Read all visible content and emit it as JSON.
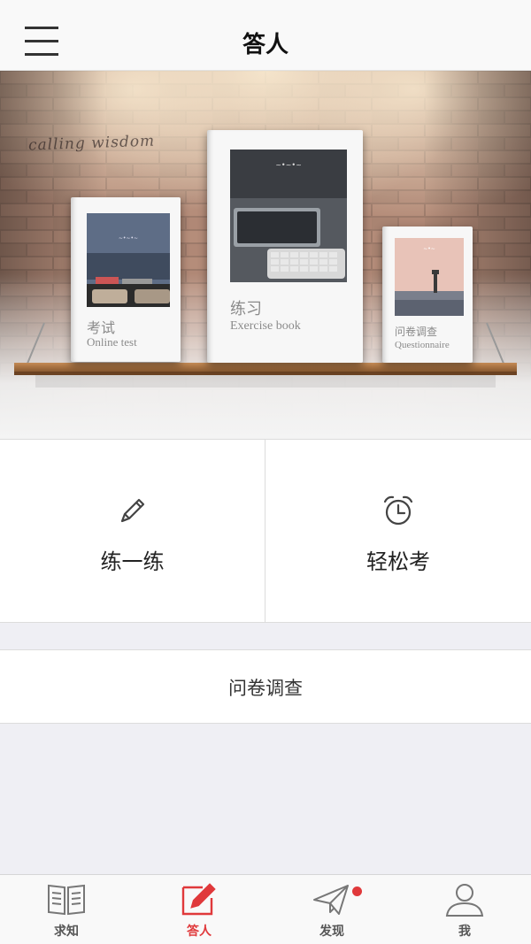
{
  "header": {
    "title": "答人",
    "menu_icon": "hamburger-menu-icon"
  },
  "banner": {
    "script_text": "calling wisdom",
    "books": [
      {
        "title_cn": "考试",
        "title_en": "Online test"
      },
      {
        "title_cn": "练习",
        "title_en": "Exercise book"
      },
      {
        "title_cn": "问卷调查",
        "title_en": "Questionnaire"
      }
    ]
  },
  "actions": {
    "practice": {
      "label": "练一练",
      "icon": "pencil-icon"
    },
    "exam": {
      "label": "轻松考",
      "icon": "alarm-clock-icon"
    }
  },
  "survey": {
    "label": "问卷调查"
  },
  "tabbar": {
    "items": [
      {
        "label": "求知",
        "icon": "book-icon"
      },
      {
        "label": "答人",
        "icon": "edit-icon"
      },
      {
        "label": "发现",
        "icon": "paper-plane-icon"
      },
      {
        "label": "我",
        "icon": "user-icon"
      }
    ],
    "active_index": 1,
    "accent_color": "#e0393b"
  }
}
